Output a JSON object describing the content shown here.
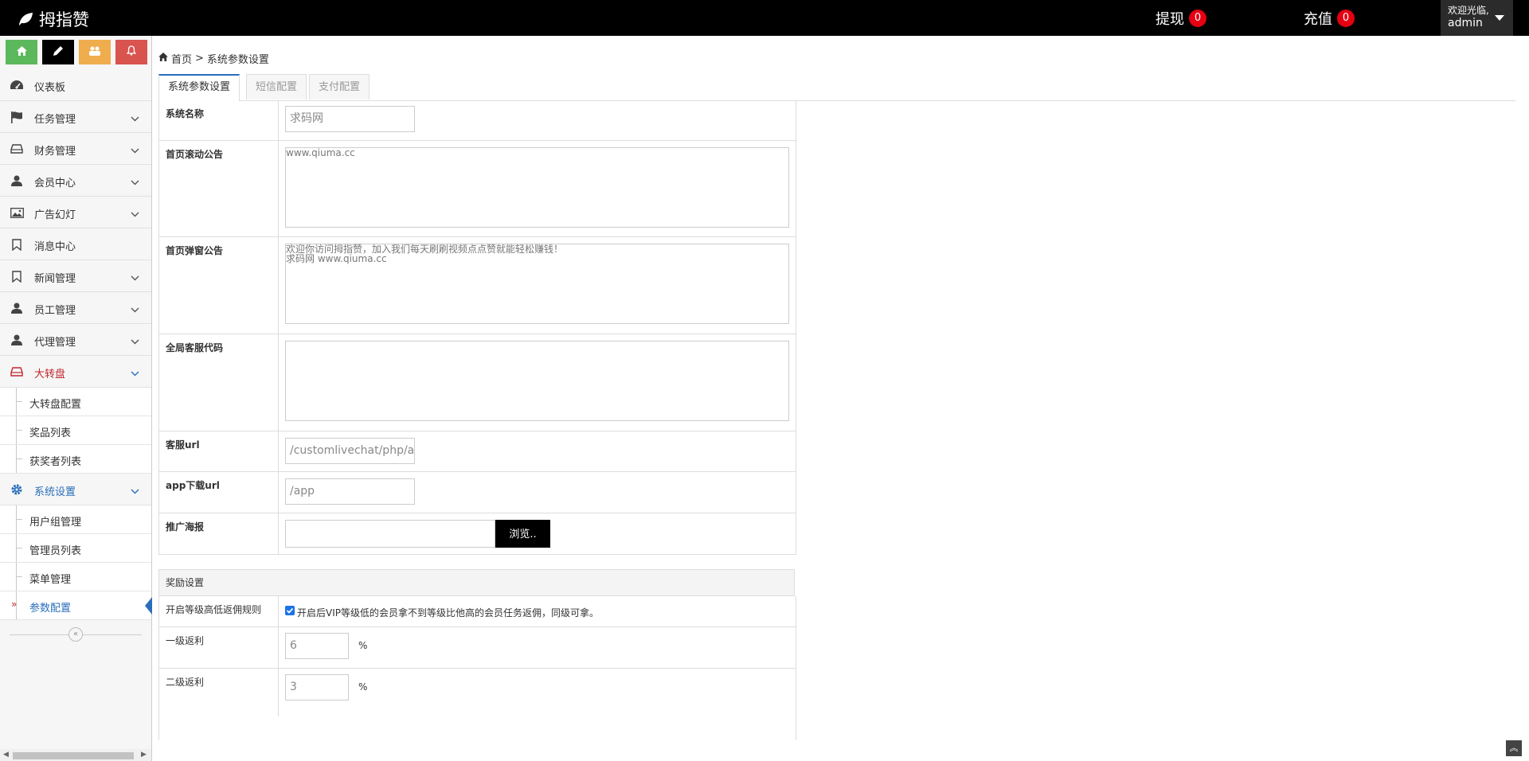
{
  "header": {
    "brand": "拇指赞",
    "withdraw_label": "提现",
    "withdraw_count": "0",
    "recharge_label": "充值",
    "recharge_count": "0",
    "welcome": "欢迎光临,",
    "username": "admin"
  },
  "shortcuts": [
    {
      "icon": "home-icon",
      "color": "#5cb85c"
    },
    {
      "icon": "pencil-icon",
      "color": "#000000"
    },
    {
      "icon": "users-icon",
      "color": "#f0ad4e"
    },
    {
      "icon": "bell-icon",
      "color": "#d9534f"
    }
  ],
  "sidebar": {
    "items": [
      {
        "label": "仪表板",
        "icon": "dashboard-icon"
      },
      {
        "label": "任务管理",
        "icon": "flag-icon"
      },
      {
        "label": "财务管理",
        "icon": "hdd-icon"
      },
      {
        "label": "会员中心",
        "icon": "user-icon"
      },
      {
        "label": "广告幻灯",
        "icon": "picture-icon"
      },
      {
        "label": "消息中心",
        "icon": "bookmark-icon"
      },
      {
        "label": "新闻管理",
        "icon": "bookmark-icon"
      },
      {
        "label": "员工管理",
        "icon": "user-icon"
      },
      {
        "label": "代理管理",
        "icon": "user-icon"
      },
      {
        "label": "大转盘",
        "icon": "hdd-icon"
      },
      {
        "label": "系统设置",
        "icon": "gear-icon"
      }
    ],
    "wheel_sub": [
      "大转盘配置",
      "奖品列表",
      "获奖者列表"
    ],
    "system_sub": [
      "用户组管理",
      "管理员列表",
      "菜单管理",
      "参数配置"
    ]
  },
  "breadcrumb": {
    "home": "首页",
    "separator": ">",
    "current": "系统参数设置"
  },
  "tabs": [
    "系统参数设置",
    "短信配置",
    "支付配置"
  ],
  "form": {
    "site_name_label": "系统名称",
    "site_name_value": "求码网",
    "scroll_notice_label": "首页滚动公告",
    "scroll_notice_value": "www.qiuma.cc",
    "popup_notice_label": "首页弹窗公告",
    "popup_notice_value": "欢迎你访问拇指赞，加入我们每天刷刷视频点点赞就能轻松赚钱！\n求码网 www.qiuma.cc",
    "service_code_label": "全局客服代码",
    "service_code_value": "",
    "service_url_label": "客服url",
    "service_url_value": "/customlivechat/php/a",
    "app_url_label": "app下载url",
    "app_url_value": "/app",
    "poster_label": "推广海报",
    "browse_label": "浏览.."
  },
  "reward": {
    "section_title": "奖励设置",
    "rule_label": "开启等级高低返佣规则",
    "rule_text": "开启后VIP等级低的会员拿不到等级比他高的会员任务返佣，同级可拿。",
    "rule_checked": true,
    "level1_label": "一级返利",
    "level1_value": "6",
    "level2_label": "二级返利",
    "level2_value": "3",
    "unit": "%"
  }
}
